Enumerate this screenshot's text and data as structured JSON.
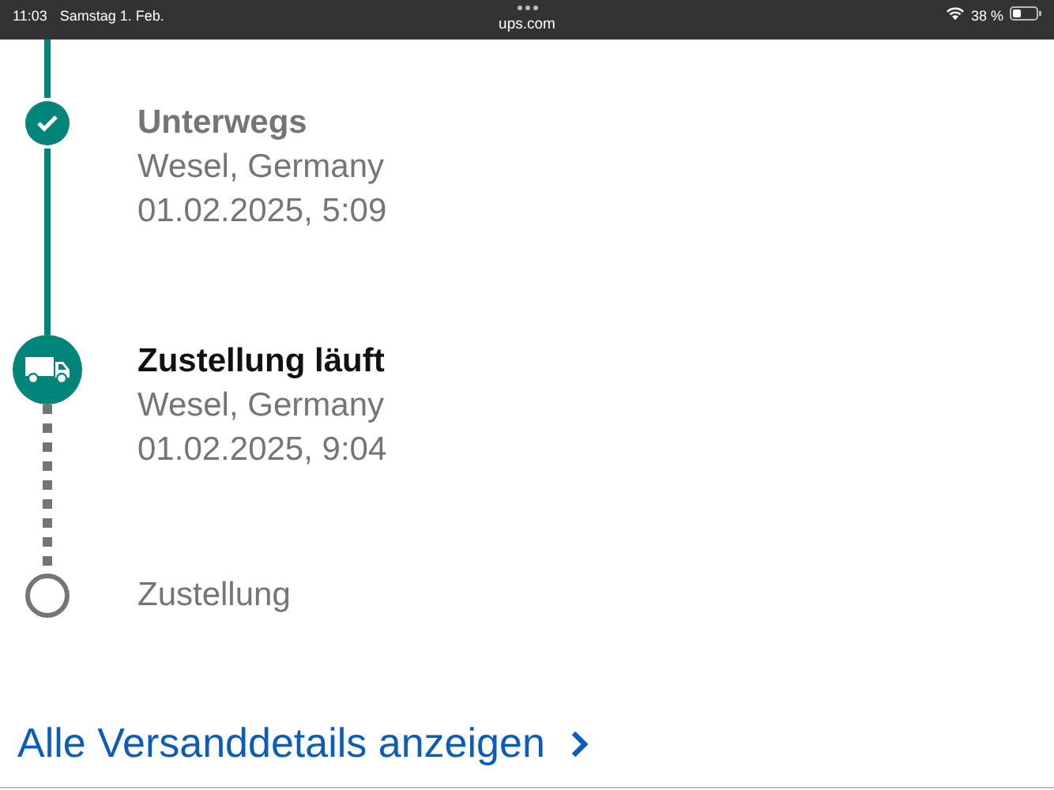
{
  "status_bar": {
    "time": "11:03",
    "date": "Samstag 1. Feb.",
    "url": "ups.com",
    "battery": "38 %"
  },
  "steps": [
    {
      "kind": "done",
      "title": "Unterwegs",
      "location": "Wesel, Germany",
      "datetime": "01.02.2025, 5:09"
    },
    {
      "kind": "current",
      "title": "Zustellung läuft",
      "location": "Wesel, Germany",
      "datetime": "01.02.2025, 9:04"
    },
    {
      "kind": "pending",
      "title": "Zustellung"
    }
  ],
  "details_link": "Alle Versanddetails anzeigen"
}
